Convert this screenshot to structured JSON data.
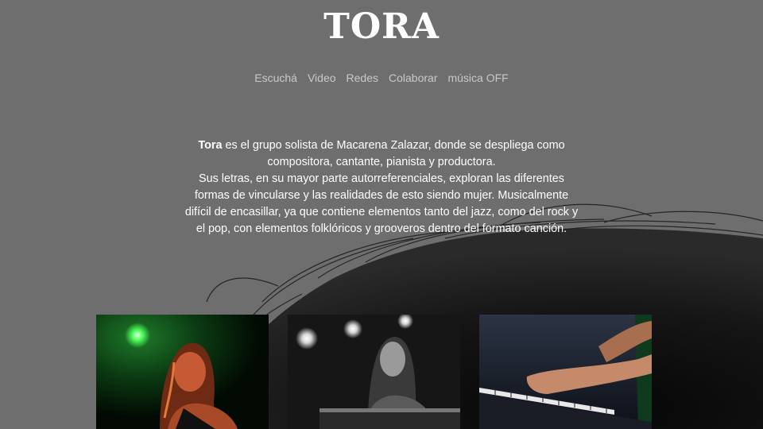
{
  "site": {
    "title": "TORA"
  },
  "nav": {
    "items": [
      {
        "label": "Escuchá"
      },
      {
        "label": "Video"
      },
      {
        "label": "Redes"
      },
      {
        "label": "Colaborar"
      },
      {
        "label": "música OFF"
      }
    ]
  },
  "intro": {
    "name": "Tora",
    "line1": " es el grupo solista de Macarena Zalazar, donde se despliega como compositora, cantante, pianista y productora.",
    "line2": "Sus letras, en su mayor parte autorreferenciales, exploran las diferentes formas de vincularse y las realidades de esto siendo mujer. Musicalmente difícil de encasillar, ya que contiene elementos tanto del jazz, como del rock y el pop, con elementos folklóricos y grooveros dentro del formato canción."
  },
  "gallery": {
    "photos": [
      {
        "subject": "singer-under-green-stage-light"
      },
      {
        "subject": "pianist-black-and-white"
      },
      {
        "subject": "hands-on-keyboard"
      }
    ]
  },
  "colors": {
    "background": "#6e6e6e",
    "title": "#ffffff",
    "nav_text": "#c9c9c9",
    "body_text": "#ffffff"
  }
}
